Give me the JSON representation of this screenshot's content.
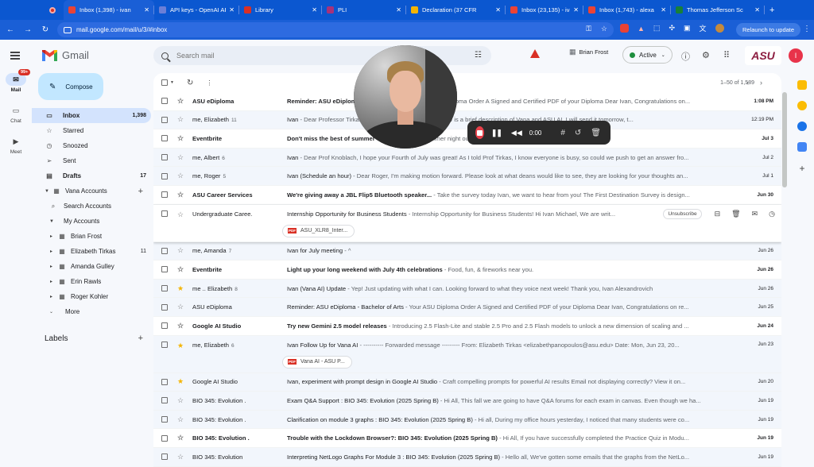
{
  "browser": {
    "tabs": [
      {
        "title": "Inbox (1,398) - ivan",
        "favicon_color": "#ea4335",
        "active": true
      },
      {
        "title": "API keys - OpenAI API",
        "favicon_color": "#6b7fd7"
      },
      {
        "title": "Library",
        "favicon_color": "#d93025"
      },
      {
        "title": "PLI",
        "favicon_color": "#a83279"
      },
      {
        "title": "Declaration (37 CFR",
        "favicon_color": "#f4b400"
      },
      {
        "title": "Inbox (23,135) - ivan",
        "favicon_color": "#ea4335"
      },
      {
        "title": "Inbox (1,743) - alexa",
        "favicon_color": "#ea4335"
      },
      {
        "title": "Thomas Jefferson Sc",
        "favicon_color": "#188038"
      }
    ],
    "url": "mail.google.com/mail/u/3/#inbox",
    "relaunch_label": "Relaunch to update"
  },
  "header": {
    "logo_text": "Gmail",
    "search_placeholder": "Search mail",
    "account_name": "Brian Frost",
    "status_label": "Active",
    "org_logo": "ASU",
    "avatar_letter": "I"
  },
  "rail": [
    {
      "label": "Mail",
      "icon": "mail-icon",
      "badge": "99+"
    },
    {
      "label": "Chat",
      "icon": "chat-icon"
    },
    {
      "label": "Meet",
      "icon": "video-icon"
    }
  ],
  "sidebar": {
    "compose_label": "Compose",
    "items": [
      {
        "label": "Inbox",
        "count": "1,398",
        "icon": "inbox-icon",
        "glyph": "▭"
      },
      {
        "label": "Starred",
        "count": "",
        "icon": "star-icon",
        "glyph": "☆"
      },
      {
        "label": "Snoozed",
        "count": "",
        "icon": "clock-icon",
        "glyph": "◷"
      },
      {
        "label": "Sent",
        "count": "",
        "icon": "send-icon",
        "glyph": "➢"
      },
      {
        "label": "Drafts",
        "count": "17",
        "icon": "draft-icon",
        "glyph": "▤"
      }
    ],
    "vana_accounts": "Vana Accounts",
    "search_accounts": "Search Accounts",
    "my_accounts": "My Accounts",
    "accounts": [
      {
        "label": "Brian Frost",
        "count": ""
      },
      {
        "label": "Elizabeth Tirkas",
        "count": "11"
      },
      {
        "label": "Amanda Gulley",
        "count": ""
      },
      {
        "label": "Erin Rawls",
        "count": ""
      },
      {
        "label": "Roger Kohler",
        "count": ""
      }
    ],
    "more_label": "More",
    "labels_heading": "Labels"
  },
  "list": {
    "pager": "1–50 of 1,589",
    "unsubscribe_label": "Unsubscribe",
    "emails": [
      {
        "from": "ASU eDiploma",
        "n": "",
        "subject": "Reminder: ASU eDiploma - Bachelor of Arts",
        "snippet": " - Your ASU Diploma Order A Signed and Certified PDF of your Diploma Dear Ivan, Congratulations on...",
        "date": "1:08 PM",
        "unread": true,
        "starred": false
      },
      {
        "from": "me, Elizabeth",
        "n": "11",
        "subject": "Ivan",
        "snippet": " - Dear Professor Tirkas, I hope you are doing well. Below is a brief description of Vana and ASU AI. I will send it tomorrow, t...",
        "date": "12:19 PM",
        "unread": false,
        "starred": false
      },
      {
        "from": "Eventbrite",
        "n": "",
        "subject": "Don't miss the best of summer",
        "snippet": " - Find the perfect summer night out near you",
        "date": "Jul 3",
        "unread": true,
        "starred": false
      },
      {
        "from": "me, Albert",
        "n": "6",
        "subject": "Ivan",
        "snippet": " - Dear Prof Knoblach, I hope your Fourth of July was great! As I told Prof Tirkas, I know everyone is busy, so could we push to get an answer fro...",
        "date": "Jul 2",
        "unread": false,
        "starred": false
      },
      {
        "from": "me, Roger",
        "n": "5",
        "subject": "Ivan (Schedule an hour)",
        "snippet": " - Dear Roger, I'm making motion forward. Please look at what deans would like to see, they are looking for your thoughts an...",
        "date": "Jul 1",
        "unread": false,
        "starred": false
      },
      {
        "from": "ASU Career Services",
        "n": "",
        "subject": "We're giving away a JBL Flip5 Bluetooth speaker...",
        "snippet": " - Take the survey today Ivan, we want to hear from you! The First Destination Survey is design...",
        "date": "Jun 30",
        "unread": true,
        "starred": false
      },
      {
        "from": "Undergraduate Caree.",
        "n": "",
        "subject": "Internship Opportunity for Business Students",
        "snippet": " - Internship Opportunity for Business Students! Hi Ivan Michael, We are writ...",
        "date": "",
        "unread": false,
        "starred": false,
        "hover": true,
        "attachment": "ASU_XLR8_Inter..."
      },
      {
        "from": "me, Amanda",
        "n": "7",
        "subject": "Ivan for July meeting",
        "snippet": " - ^",
        "date": "Jun 26",
        "unread": false,
        "starred": false
      },
      {
        "from": "Eventbrite",
        "n": "",
        "subject": "Light up your long weekend with July 4th celebrations",
        "snippet": " - Food, fun, & fireworks near you.",
        "date": "Jun 26",
        "unread": true,
        "starred": false
      },
      {
        "from": "me .. Elizabeth",
        "n": "8",
        "subject": "Ivan (Vana AI) Update",
        "snippet": " - Yep! Just updating with what I can. Looking forward to what they voice next week! Thank you, Ivan Alexandrovich",
        "date": "Jun 26",
        "unread": false,
        "starred": true
      },
      {
        "from": "ASU eDiploma",
        "n": "",
        "subject": "Reminder: ASU eDiploma - Bachelor of Arts",
        "snippet": " - Your ASU Diploma Order A Signed and Certified PDF of your Diploma Dear Ivan, Congratulations on re...",
        "date": "Jun 25",
        "unread": false,
        "starred": false
      },
      {
        "from": "Google AI Studio",
        "n": "",
        "subject": "Try new Gemini 2.5 model releases",
        "snippet": " - Introducing 2.5 Flash-Lite and stable 2.5 Pro and 2.5 Flash models to unlock a new dimension of scaling and ...",
        "date": "Jun 24",
        "unread": true,
        "starred": false
      },
      {
        "from": "me, Elizabeth",
        "n": "6",
        "subject": "Ivan Follow Up for Vana AI",
        "snippet": " - ---------- Forwarded message --------- From: Elizabeth Tirkas <elizabethpanopoulos@asu.edu> Date: Mon, Jun 23, 20...",
        "date": "Jun 23",
        "unread": false,
        "starred": true,
        "attachment": "Vana AI - ASU P..."
      },
      {
        "from": "Google AI Studio",
        "n": "",
        "subject": "Ivan, experiment with prompt design in Google AI Studio",
        "snippet": " - Craft compelling prompts for powerful AI results Email not displaying correctly? View it on...",
        "date": "Jun 20",
        "unread": false,
        "starred": true
      },
      {
        "from": "BIO 345: Evolution .",
        "n": "",
        "subject": "Exam Q&A Support : BIO 345: Evolution (2025 Spring B)",
        "snippet": " - Hi All, This fall we are going to have Q&A forums for each exam in canvas. Even though we ha...",
        "date": "Jun 19",
        "unread": false,
        "starred": false
      },
      {
        "from": "BIO 345: Evolution .",
        "n": "",
        "subject": "Clarification on module 3 graphs : BIO 345: Evolution (2025 Spring B)",
        "snippet": " - Hi all, During my office hours yesterday, I noticed that many students were co...",
        "date": "Jun 19",
        "unread": false,
        "starred": false
      },
      {
        "from": "BIO 345: Evolution .",
        "n": "",
        "subject": "Trouble with the Lockdown Browser?: BIO 345: Evolution (2025 Spring B)",
        "snippet": " - Hi All, If you have successfully completed the Practice Quiz in Modu...",
        "date": "Jun 19",
        "unread": true,
        "starred": false
      },
      {
        "from": "BIO 345: Evolution",
        "n": "",
        "subject": "Interpreting NetLogo Graphs For Module 3 : BIO 345: Evolution (2025 Spring B)",
        "snippet": " - Hello all, We've gotten some emails that the graphs from the NetLo...",
        "date": "Jun 19",
        "unread": false,
        "starred": false
      }
    ]
  },
  "recorder": {
    "time": "0:00"
  },
  "colors": {
    "accent": "#0b57d0",
    "unread_bg": "#ffffff",
    "read_bg": "#f2f6fc",
    "star": "#f4b400"
  }
}
